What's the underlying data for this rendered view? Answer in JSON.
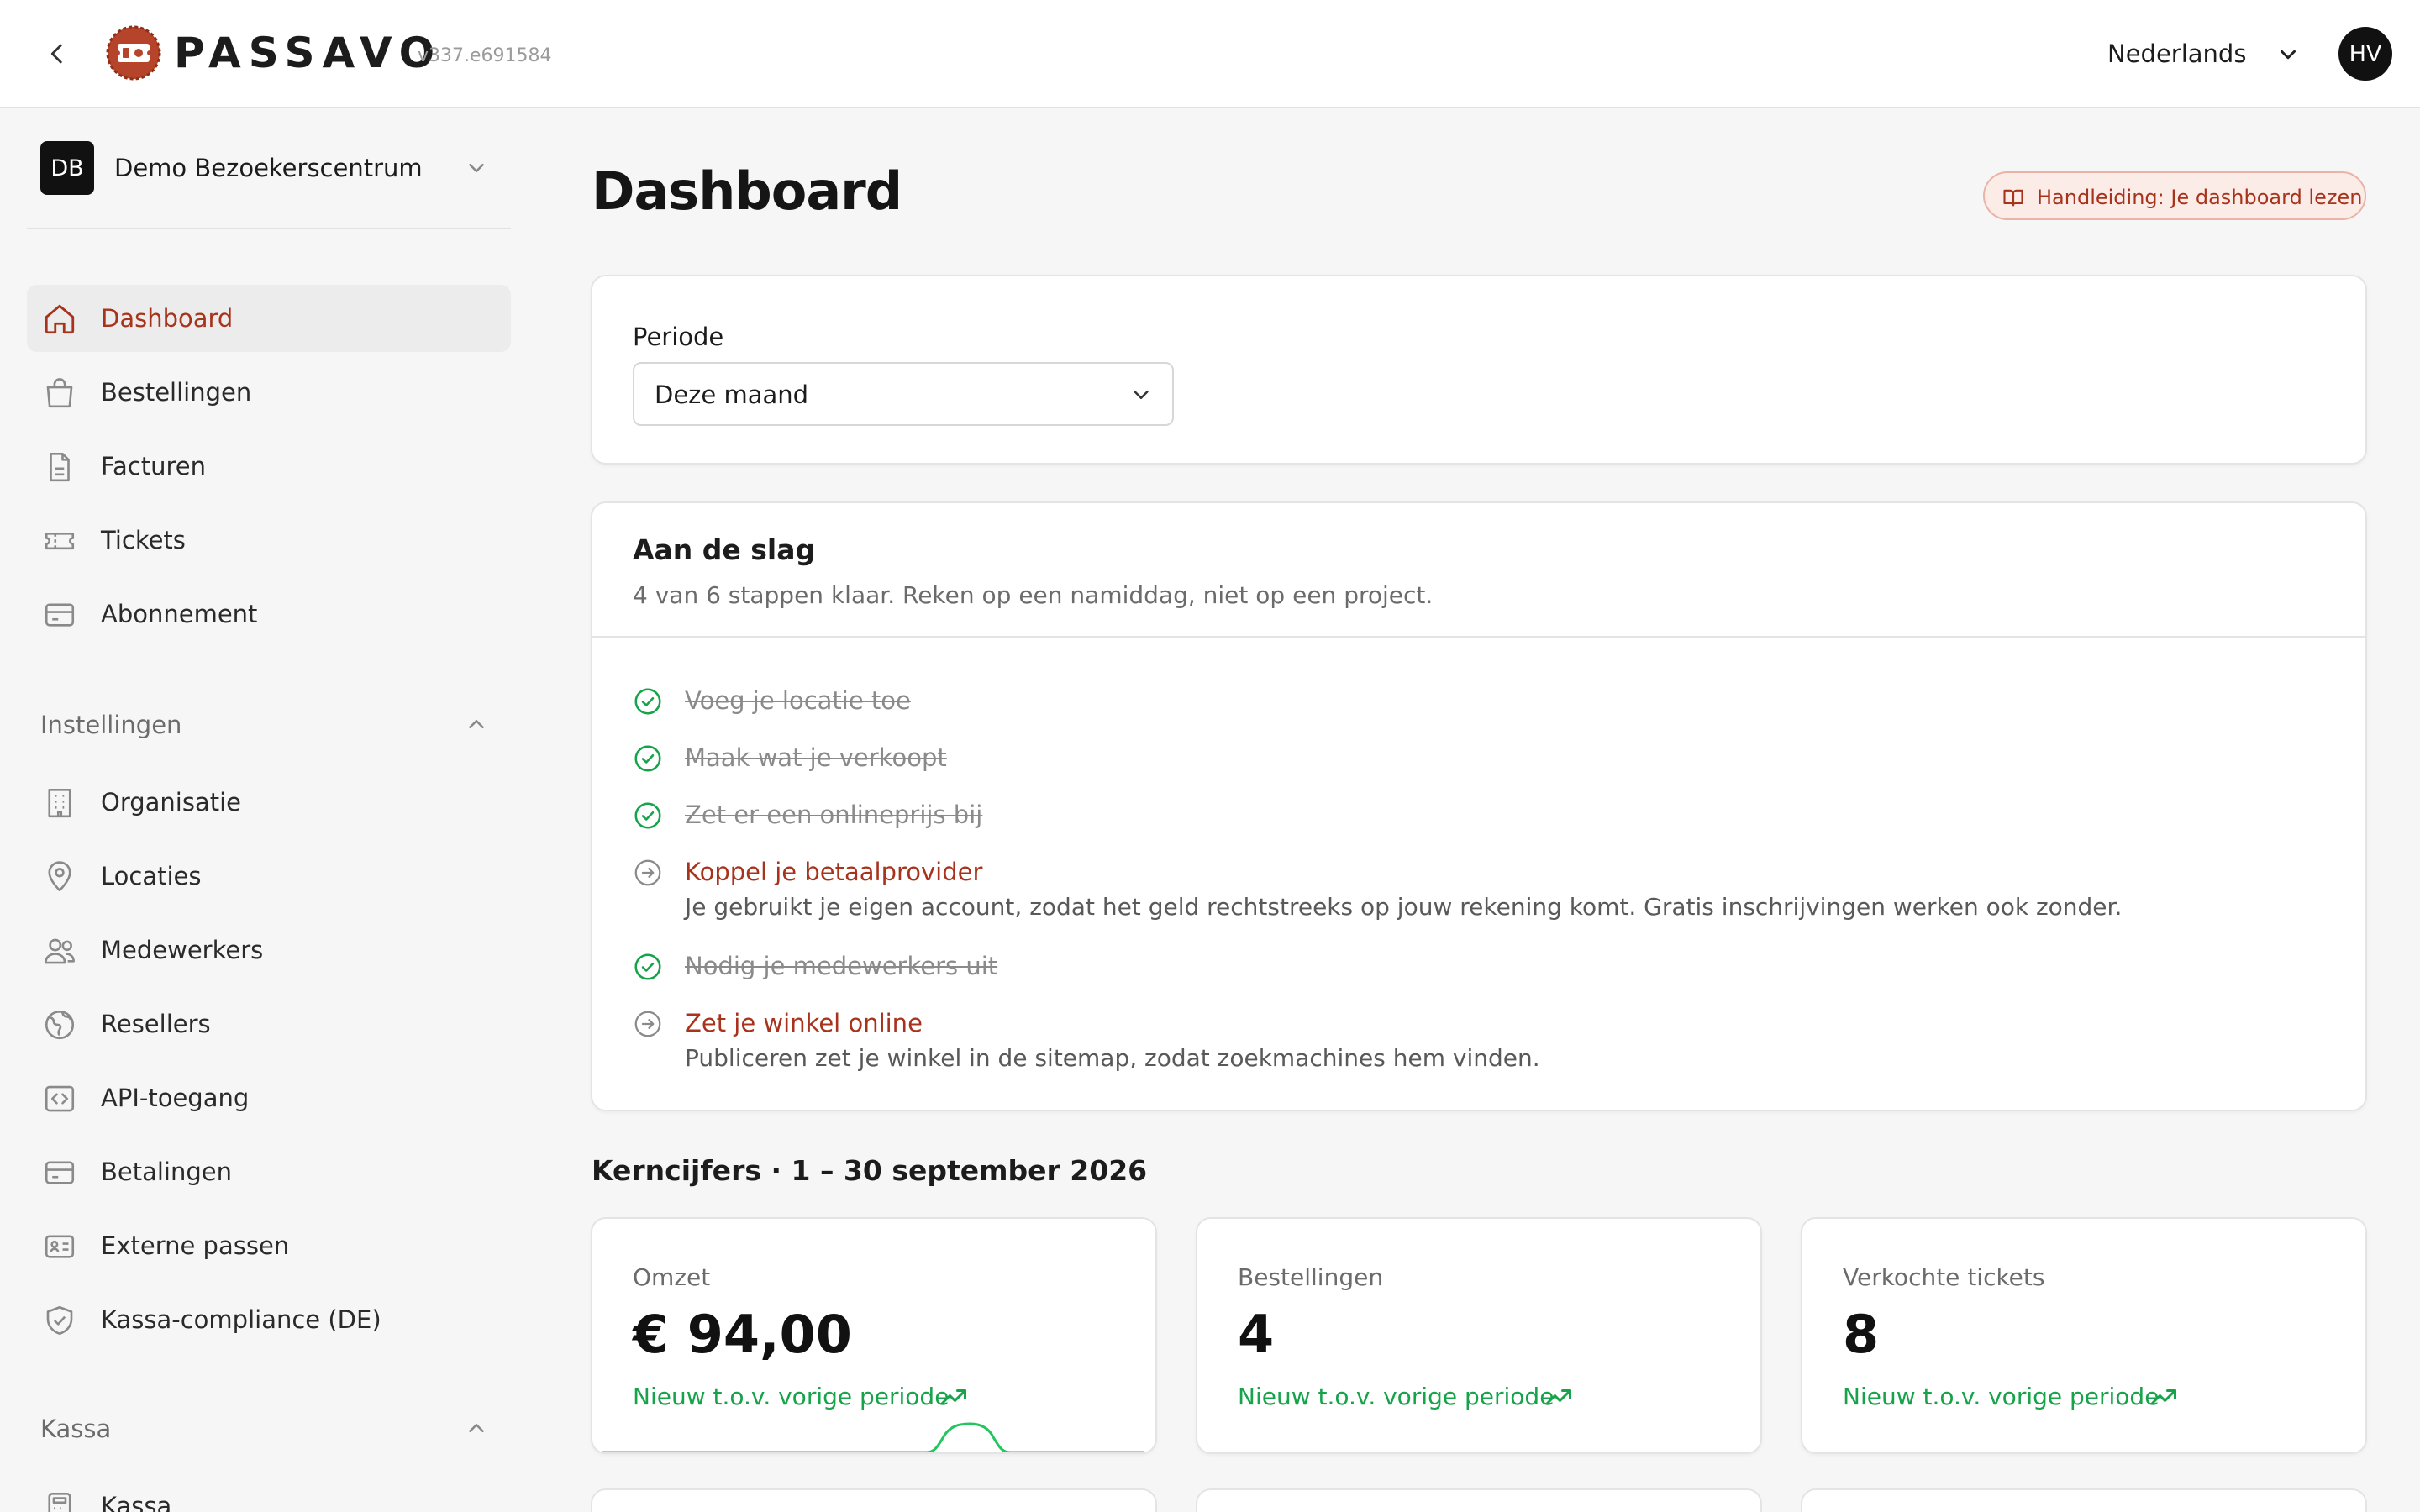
{
  "topbar": {
    "brand": "PASSAVO",
    "version": "v337.e691584",
    "language": "Nederlands",
    "user_initials": "HV"
  },
  "sidebar": {
    "org": {
      "initials": "DB",
      "name": "Demo Bezoekerscentrum"
    },
    "main_items": [
      {
        "label": "Dashboard",
        "icon": "home-icon",
        "active": true
      },
      {
        "label": "Bestellingen",
        "icon": "shopping-bag-icon"
      },
      {
        "label": "Facturen",
        "icon": "file-icon"
      },
      {
        "label": "Tickets",
        "icon": "ticket-icon"
      },
      {
        "label": "Abonnement",
        "icon": "credit-card-icon"
      }
    ],
    "settings": {
      "label": "Instellingen",
      "items": [
        {
          "label": "Organisatie",
          "icon": "building-icon"
        },
        {
          "label": "Locaties",
          "icon": "map-pin-icon"
        },
        {
          "label": "Medewerkers",
          "icon": "users-icon"
        },
        {
          "label": "Resellers",
          "icon": "globe-icon"
        },
        {
          "label": "API-toegang",
          "icon": "code-icon"
        },
        {
          "label": "Betalingen",
          "icon": "credit-card-icon"
        },
        {
          "label": "Externe passen",
          "icon": "id-card-icon"
        },
        {
          "label": "Kassa-compliance (DE)",
          "icon": "shield-check-icon"
        }
      ]
    },
    "kassa": {
      "label": "Kassa",
      "items": [
        {
          "label": "Kassa",
          "icon": "calculator-icon"
        }
      ]
    }
  },
  "main": {
    "title": "Dashboard",
    "guide_link": "Handleiding: Je dashboard lezen",
    "period": {
      "label": "Periode",
      "value": "Deze maand"
    },
    "getting_started": {
      "title": "Aan de slag",
      "subtitle": "4 van 6 stappen klaar. Reken op een namiddag, niet op een project.",
      "steps": [
        {
          "title": "Voeg je locatie toe",
          "done": true
        },
        {
          "title": "Maak wat je verkoopt",
          "done": true
        },
        {
          "title": "Zet er een onlineprijs bij",
          "done": true
        },
        {
          "title": "Koppel je betaalprovider",
          "done": false,
          "description": "Je gebruikt je eigen account, zodat het geld rechtstreeks op jouw rekening komt. Gratis inschrijvingen werken ook zonder."
        },
        {
          "title": "Nodig je medewerkers uit",
          "done": true
        },
        {
          "title": "Zet je winkel online",
          "done": false,
          "description": "Publiceren zet je winkel in de sitemap, zodat zoekmachines hem vinden."
        }
      ]
    },
    "kpi": {
      "heading": "Kerncijfers · 1 – 30 september 2026",
      "cards": [
        {
          "label": "Omzet",
          "value": "€ 94,00",
          "trend": "Nieuw t.o.v. vorige periode"
        },
        {
          "label": "Bestellingen",
          "value": "4",
          "trend": "Nieuw t.o.v. vorige periode"
        },
        {
          "label": "Verkochte tickets",
          "value": "8",
          "trend": "Nieuw t.o.v. vorige periode"
        }
      ]
    }
  },
  "colors": {
    "accent": "#a8331c",
    "success": "#16a34a",
    "logo": "#b5442a"
  }
}
